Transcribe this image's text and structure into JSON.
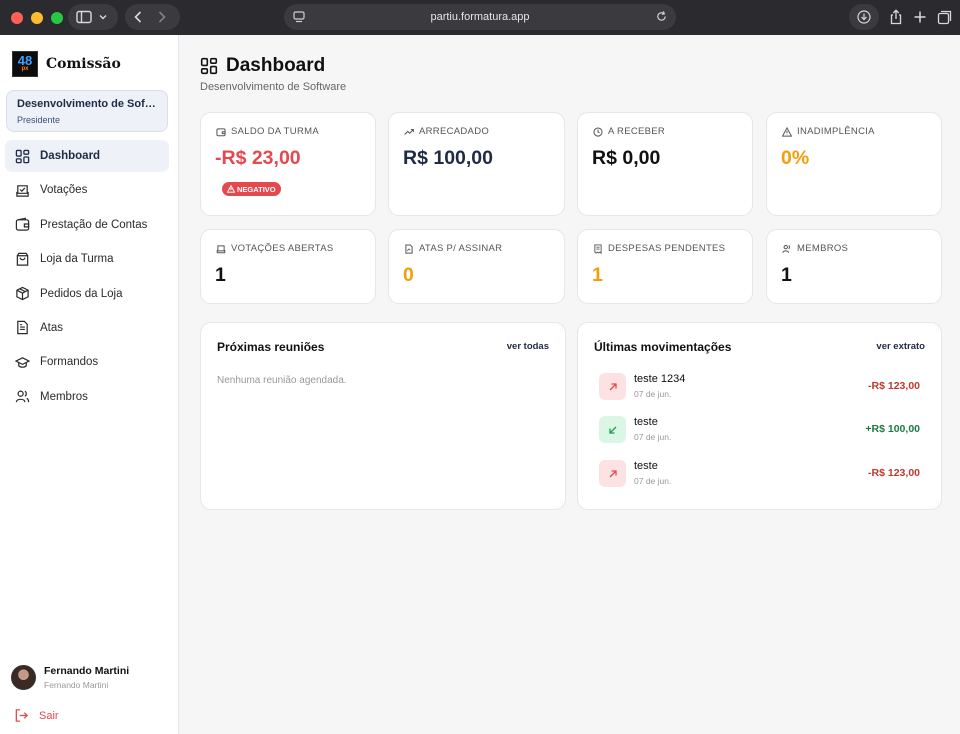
{
  "browser": {
    "url": "partiu.formatura.app"
  },
  "sidebar": {
    "logo_text": "48",
    "logo_sub": "px",
    "brand": "Comissão",
    "class_name": "Desenvolvimento de Software",
    "role": "Presidente",
    "items": [
      {
        "label": "Dashboard",
        "icon": "dashboard-icon",
        "active": true
      },
      {
        "label": "Votações",
        "icon": "vote-icon"
      },
      {
        "label": "Prestação de Contas",
        "icon": "wallet-icon"
      },
      {
        "label": "Loja da Turma",
        "icon": "shopping-bag-icon"
      },
      {
        "label": "Pedidos da Loja",
        "icon": "package-icon"
      },
      {
        "label": "Atas",
        "icon": "document-icon"
      },
      {
        "label": "Formandos",
        "icon": "graduation-cap-icon"
      },
      {
        "label": "Membros",
        "icon": "users-icon"
      }
    ],
    "user_name": "Fernando Martini",
    "user_sub": "Fernando Martini",
    "logout": "Sair"
  },
  "header": {
    "title": "Dashboard",
    "subtitle": "Desenvolvimento de Software"
  },
  "stats": [
    {
      "label": "SALDO DA TURMA",
      "value": "-R$ 23,00",
      "color": "#e5484d",
      "icon": "wallet-icon",
      "badge": "NEGATIVO"
    },
    {
      "label": "ARRECADADO",
      "value": "R$ 100,00",
      "color": "#1f2a44",
      "icon": "trending-up-icon"
    },
    {
      "label": "A RECEBER",
      "value": "R$ 0,00",
      "color": "#111111",
      "icon": "clock-icon"
    },
    {
      "label": "INADIMPLÊNCIA",
      "value": "0%",
      "color": "#f59e0b",
      "icon": "alert-triangle-icon"
    },
    {
      "label": "VOTAÇÕES ABERTAS",
      "value": "1",
      "color": "#111111",
      "icon": "vote-icon"
    },
    {
      "label": "ATAS P/ ASSINAR",
      "value": "0",
      "color": "#f59e0b",
      "icon": "file-signature-icon"
    },
    {
      "label": "DESPESAS PENDENTES",
      "value": "1",
      "color": "#f59e0b",
      "icon": "receipt-icon"
    },
    {
      "label": "MEMBROS",
      "value": "1",
      "color": "#111111",
      "icon": "users-icon"
    }
  ],
  "meetings": {
    "title": "Próximas reuniões",
    "link": "ver todas",
    "empty": "Nenhuma reunião agendada."
  },
  "transactions": {
    "title": "Últimas movimentações",
    "link": "ver extrato",
    "items": [
      {
        "name": "teste 1234",
        "date": "07 de jun.",
        "amount": "-R$ 123,00",
        "type": "out",
        "color": "#c0392b"
      },
      {
        "name": "teste",
        "date": "07 de jun.",
        "amount": "+R$ 100,00",
        "type": "in",
        "color": "#1e7a45"
      },
      {
        "name": "teste",
        "date": "07 de jun.",
        "amount": "-R$ 123,00",
        "type": "out",
        "color": "#c0392b"
      }
    ]
  }
}
